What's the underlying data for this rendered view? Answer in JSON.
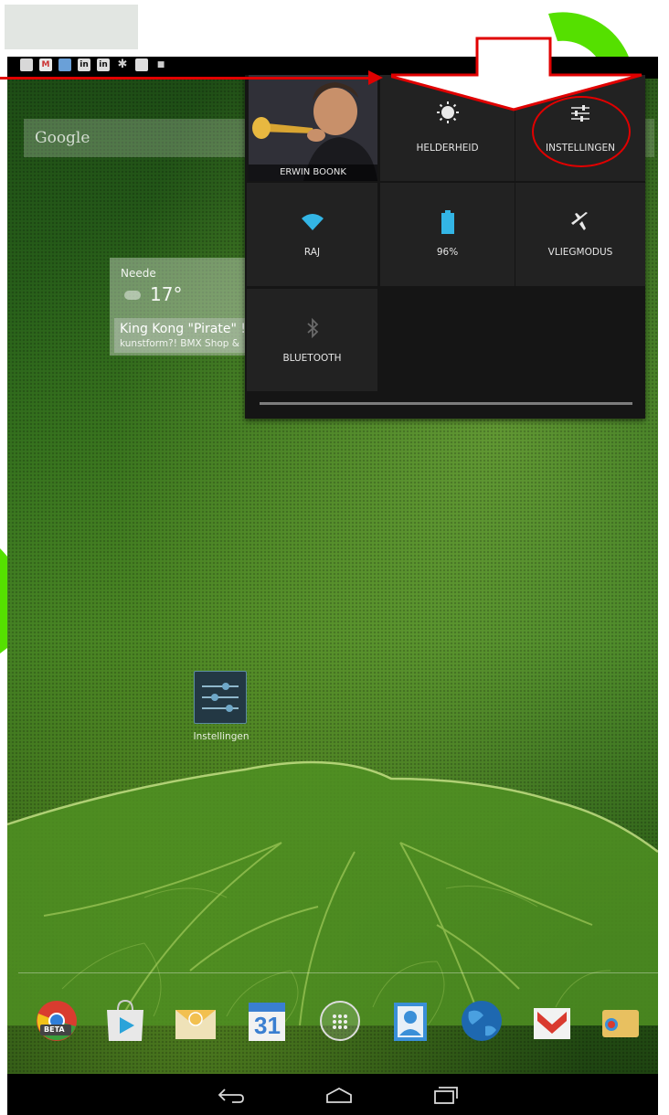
{
  "status_bar": {
    "notification_icons": [
      "picture-icon",
      "gmail-icon",
      "email-icon",
      "linkedin-icon",
      "linkedin-icon",
      "settings-icon",
      "flipboard-icon",
      "camera-icon"
    ]
  },
  "search": {
    "placeholder": "Google"
  },
  "weather_widget": {
    "city": "Neede",
    "temperature": "17°",
    "news_title": "King Kong \"Pirate\" !",
    "news_subtitle": "kunstform?! BMX Shop &"
  },
  "quick_settings": {
    "profile_name": "ERWIN BOONK",
    "tiles": [
      {
        "label": "HELDERHEID",
        "icon": "brightness-icon"
      },
      {
        "label": "INSTELLINGEN",
        "icon": "settings-sliders-icon"
      },
      {
        "label": "RAJ",
        "icon": "wifi-icon"
      },
      {
        "label": "96%",
        "icon": "battery-icon"
      },
      {
        "label": "VLIEGMODUS",
        "icon": "airplane-icon"
      },
      {
        "label": "BLUETOOTH",
        "icon": "bluetooth-icon"
      }
    ],
    "battery_level": 0.96
  },
  "home": {
    "settings_app_label": "Instellingen"
  },
  "dock": {
    "apps": [
      "chrome-beta-icon",
      "play-store-icon",
      "email-app-icon",
      "calendar-icon",
      "app-drawer-icon",
      "contacts-icon",
      "browser-globe-icon",
      "gmail-app-icon",
      "wallet-icon"
    ],
    "chrome_badge": "BETA",
    "calendar_day": "31"
  },
  "colors": {
    "accent_blue": "#33b5e5",
    "annotation_red": "#e00000",
    "watermark_green": "#55e000"
  }
}
